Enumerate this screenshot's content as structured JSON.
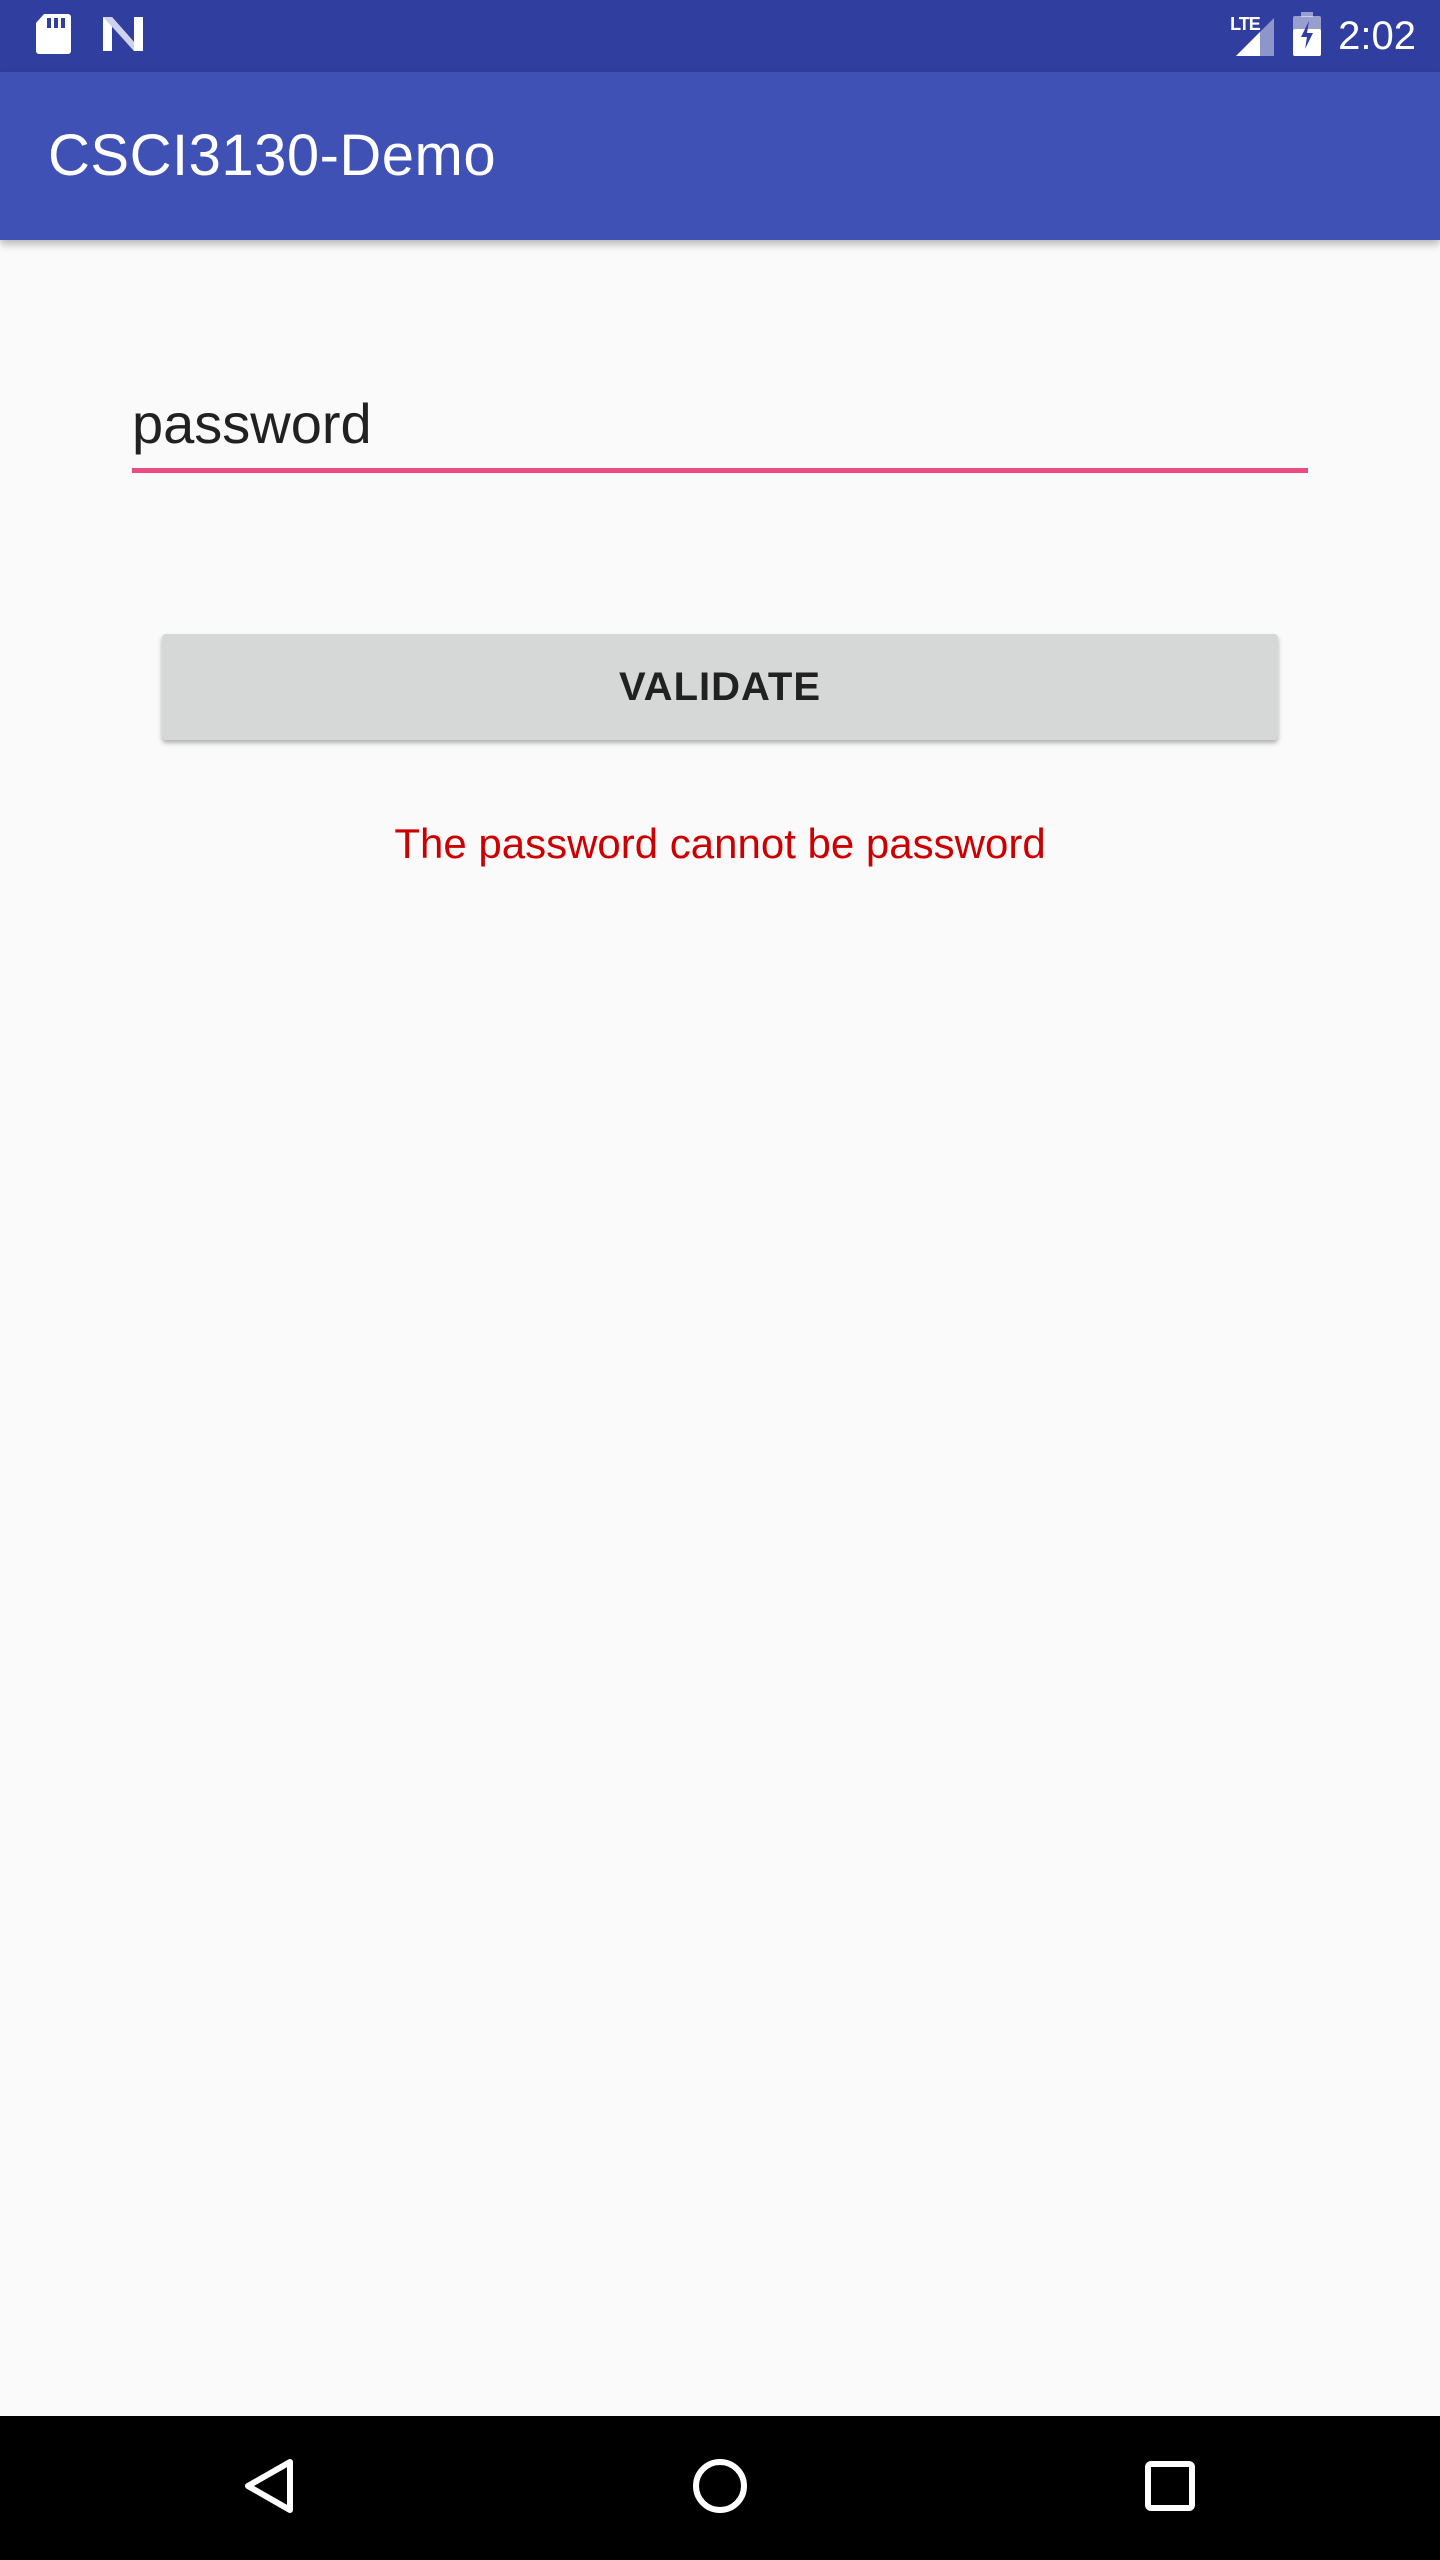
{
  "status_bar": {
    "time": "2:02",
    "network_type": "LTE",
    "left_icons": [
      "sd-card-icon",
      "n-notification-icon"
    ],
    "right_icons": [
      "signal-icon",
      "battery-charging-icon"
    ],
    "background": "#303f9f"
  },
  "app_bar": {
    "title": "CSCI3130-Demo",
    "background": "#3f51b5"
  },
  "form": {
    "password_value": "password",
    "underline_color": "#e94d82",
    "validate_label": "VALIDATE",
    "error_message": "The password cannot be password",
    "error_color": "#cc0000"
  },
  "nav_bar": {
    "buttons": [
      "back-icon",
      "home-icon",
      "recents-icon"
    ]
  }
}
